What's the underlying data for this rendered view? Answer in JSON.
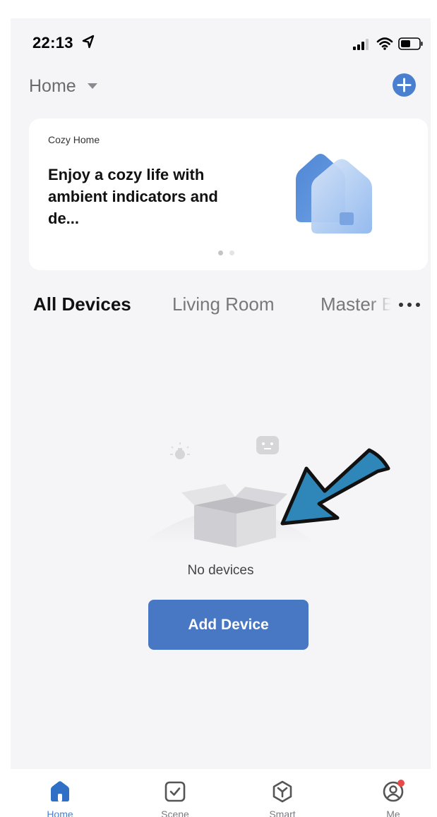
{
  "status_bar": {
    "time": "22:13",
    "icons": [
      "location-arrow-icon",
      "cellular-signal-icon",
      "wifi-icon",
      "battery-icon"
    ]
  },
  "header": {
    "title": "Home",
    "add_icon": "plus-circle-icon"
  },
  "banner": {
    "kicker": "Cozy Home",
    "headline": "Enjoy a cozy life with ambient indicators and de...",
    "page_indicator": {
      "current": 1,
      "total": 2
    }
  },
  "room_tabs": {
    "items": [
      "All Devices",
      "Living Room",
      "Master B"
    ],
    "active": "All Devices",
    "more_icon": "more-dots-icon"
  },
  "empty_state": {
    "message": "No devices",
    "button_label": "Add Device"
  },
  "tab_bar": {
    "items": [
      {
        "label": "Home",
        "icon": "home-icon",
        "active": true
      },
      {
        "label": "Scene",
        "icon": "checkbox-icon",
        "active": false
      },
      {
        "label": "Smart",
        "icon": "smart-cube-icon",
        "active": false
      },
      {
        "label": "Me",
        "icon": "profile-icon",
        "active": false,
        "badge": true
      }
    ]
  },
  "colors": {
    "accent": "#4a7fd0",
    "button": "#4877c4",
    "background": "#f5f5f7",
    "annotation_arrow": "#2f86b8",
    "badge": "#e84a4a"
  }
}
